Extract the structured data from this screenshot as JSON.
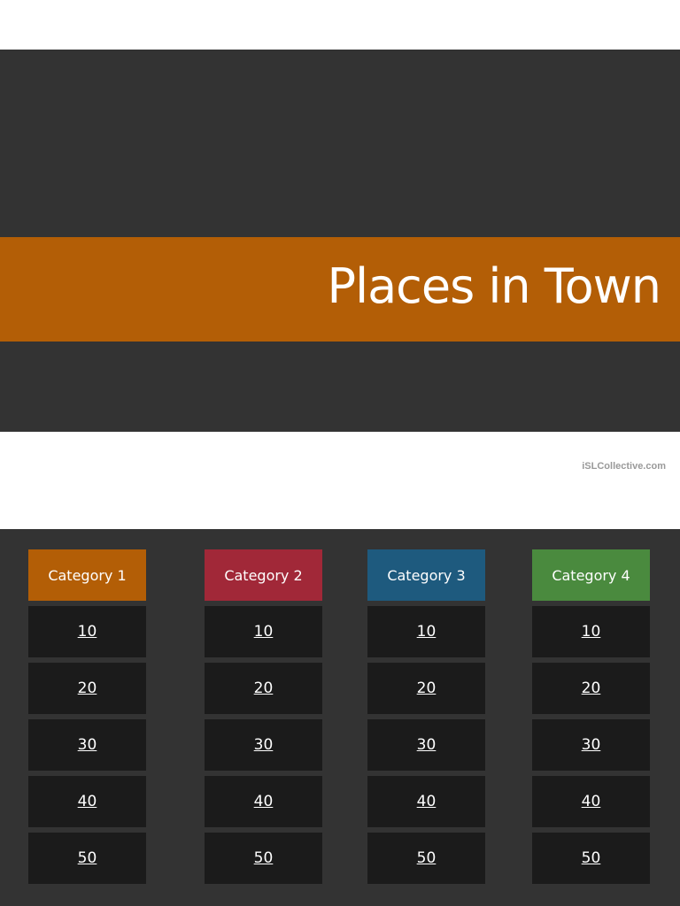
{
  "title_slide": {
    "title": "Places in Town",
    "watermark": "iSLCollective.com"
  },
  "board": {
    "categories": [
      {
        "label": "Category 1",
        "color": "#b35e06",
        "values": [
          "10",
          "20",
          "30",
          "40",
          "50"
        ]
      },
      {
        "label": "Category 2",
        "color": "#a12838",
        "values": [
          "10",
          "20",
          "30",
          "40",
          "50"
        ]
      },
      {
        "label": "Category 3",
        "color": "#1e5a7e",
        "values": [
          "10",
          "20",
          "30",
          "40",
          "50"
        ]
      },
      {
        "label": "Category 4",
        "color": "#4a8a3e",
        "values": [
          "10",
          "20",
          "30",
          "40",
          "50"
        ]
      }
    ]
  }
}
